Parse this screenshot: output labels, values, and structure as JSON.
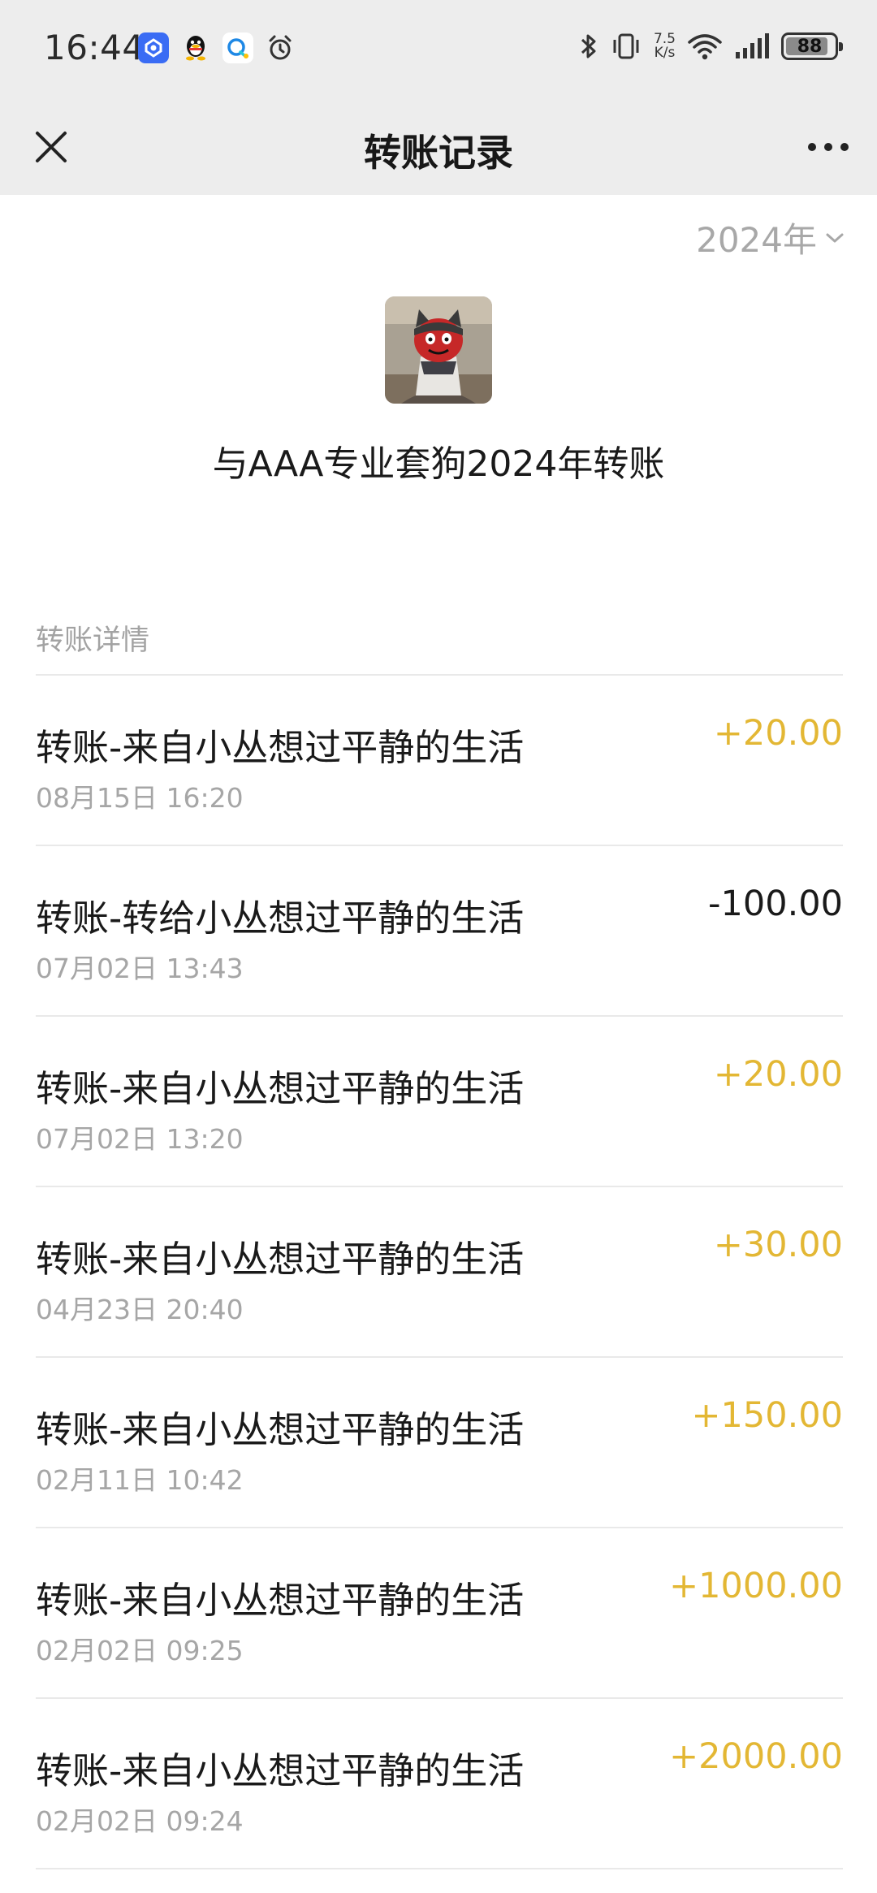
{
  "status_bar": {
    "time": "16:44",
    "net_speed_value": "7.5",
    "net_speed_unit": "K/s",
    "battery": "88",
    "battery_level": 0.88,
    "notification_icons": [
      "baidu-netdisk-icon",
      "qq-icon",
      "qq-browser-icon",
      "alarm-icon"
    ],
    "system_icons": [
      "bluetooth-icon",
      "vibrate-icon",
      "wifi-icon",
      "signal-icon",
      "battery-icon"
    ]
  },
  "nav": {
    "title": "转账记录",
    "close_icon": "close-icon",
    "more_icon": "more-icon"
  },
  "filter": {
    "year": "2024年"
  },
  "header": {
    "summary_title": "与AAA专业套狗2024年转账"
  },
  "section": {
    "label": "转账详情"
  },
  "transactions": [
    {
      "title": "转账-来自小丛想过平静的生活",
      "time": "08月15日 16:20",
      "amount": "+20.00",
      "type": "income"
    },
    {
      "title": "转账-转给小丛想过平静的生活",
      "time": "07月02日 13:43",
      "amount": "-100.00",
      "type": "expense"
    },
    {
      "title": "转账-来自小丛想过平静的生活",
      "time": "07月02日 13:20",
      "amount": "+20.00",
      "type": "income"
    },
    {
      "title": "转账-来自小丛想过平静的生活",
      "time": "04月23日 20:40",
      "amount": "+30.00",
      "type": "income"
    },
    {
      "title": "转账-来自小丛想过平静的生活",
      "time": "02月11日 10:42",
      "amount": "+150.00",
      "type": "income"
    },
    {
      "title": "转账-来自小丛想过平静的生活",
      "time": "02月02日 09:25",
      "amount": "+1000.00",
      "type": "income"
    },
    {
      "title": "转账-来自小丛想过平静的生活",
      "time": "02月02日 09:24",
      "amount": "+2000.00",
      "type": "income"
    }
  ],
  "colors": {
    "income": "#e3b734",
    "expense": "#1a1a1a",
    "nav_background": "#ededed"
  }
}
